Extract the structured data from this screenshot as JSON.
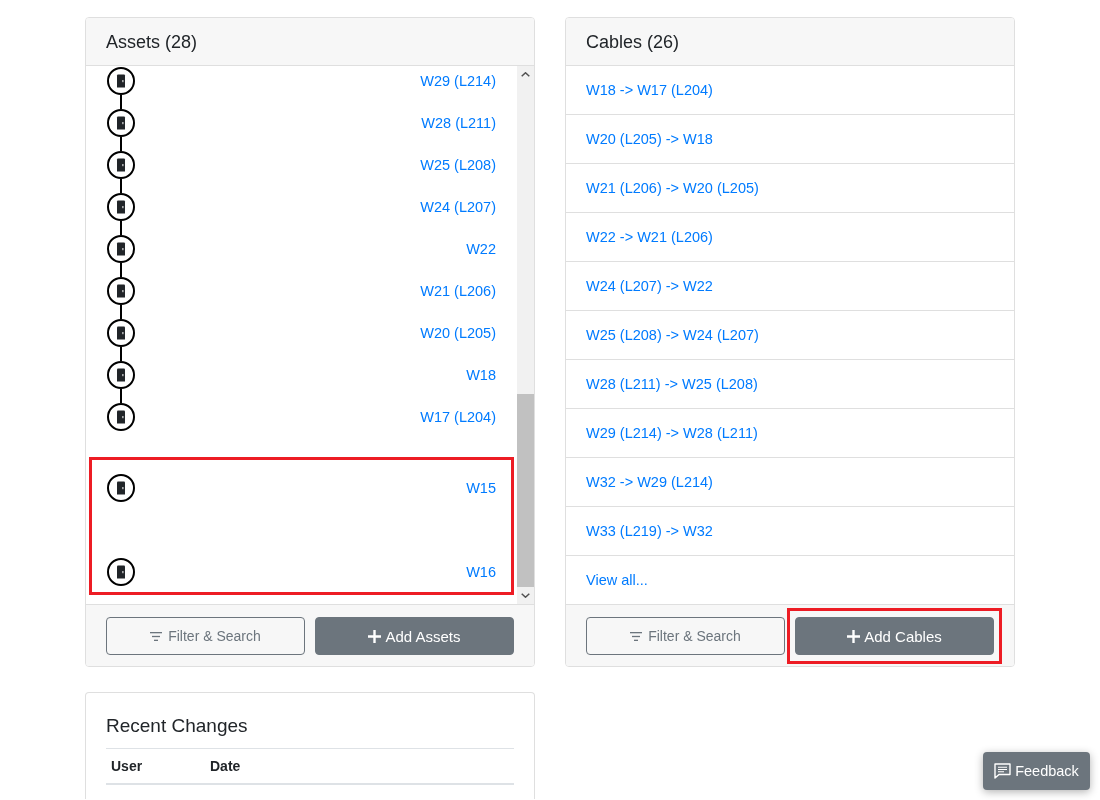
{
  "assets_panel": {
    "title": "Assets (28)",
    "groups": [
      {
        "highlighted": false,
        "chains": [
          {
            "items": [
              "W29 (L214)",
              "W28 (L211)",
              "W25 (L208)",
              "W24 (L207)",
              "W22",
              "W21 (L206)",
              "W20 (L205)",
              "W18",
              "W17 (L204)"
            ]
          }
        ]
      },
      {
        "highlighted": true,
        "chains": [
          {
            "items": [
              "W15"
            ]
          },
          {
            "items": [
              "W16"
            ]
          }
        ]
      }
    ],
    "filter_button": {
      "label": "Filter & Search"
    },
    "add_button": {
      "label": "Add Assets",
      "highlighted": false
    }
  },
  "cables_panel": {
    "title": "Cables (26)",
    "items": [
      "W18 -> W17 (L204)",
      "W20 (L205) -> W18",
      "W21 (L206) -> W20 (L205)",
      "W22 -> W21 (L206)",
      "W24 (L207) -> W22",
      "W25 (L208) -> W24 (L207)",
      "W28 (L211) -> W25 (L208)",
      "W29 (L214) -> W28 (L211)",
      "W32 -> W29 (L214)",
      "W33 (L219) -> W32"
    ],
    "view_all": "View all...",
    "filter_button": {
      "label": "Filter & Search"
    },
    "add_button": {
      "label": "Add Cables",
      "highlighted": true
    }
  },
  "recent_changes": {
    "title": "Recent Changes",
    "table": {
      "columns": [
        "User",
        "Date"
      ]
    }
  },
  "feedback_button": {
    "label": "Feedback"
  }
}
